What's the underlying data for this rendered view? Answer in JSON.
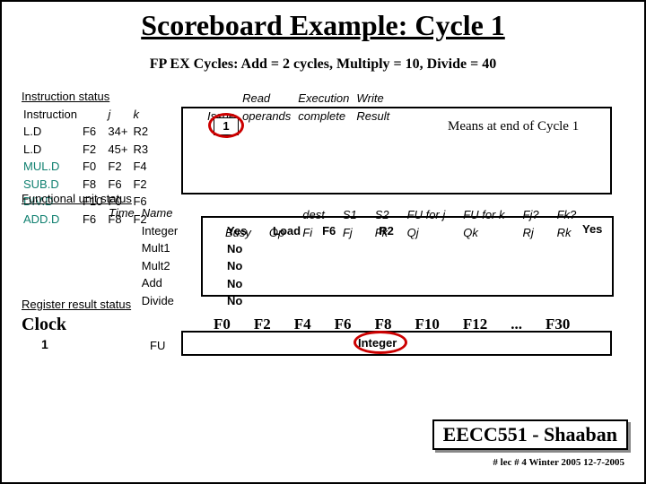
{
  "title": "Scoreboard Example:  Cycle 1",
  "subtitle": "FP EX Cycles:  Add = 2 cycles, Multiply = 10, Divide = 40",
  "instr_status_label": "Instruction status",
  "instr_header": {
    "c0": "Instruction",
    "c1": "j",
    "c2": "k"
  },
  "instructions": [
    {
      "op": "L.D",
      "dst": "F6",
      "j": "34+",
      "k": "R2"
    },
    {
      "op": "L.D",
      "dst": "F2",
      "j": "45+",
      "k": "R3"
    },
    {
      "op": "MUL.D",
      "dst": "F0",
      "j": "F2",
      "k": "F4"
    },
    {
      "op": "SUB.D",
      "dst": "F8",
      "j": "F6",
      "k": "F2"
    },
    {
      "op": "DIV.D",
      "dst": "F10",
      "j": "F0",
      "k": "F6"
    },
    {
      "op": "ADD.D",
      "dst": "F6",
      "j": "F8",
      "k": "F2"
    }
  ],
  "issue_hdr": {
    "a": "Issue",
    "b": "Read",
    "c": "operands",
    "d": "Execution",
    "e": "complete",
    "f": "Write",
    "g": "Result"
  },
  "issue_val": "1",
  "means": "Means at end of Cycle 1",
  "fu_status_label": "Functional unit status",
  "fu_cols": {
    "time": "Time",
    "name": "Name",
    "busy": "Busy",
    "op": "Op",
    "fi": "Fi",
    "fj": "Fj",
    "fk": "Fk",
    "qj": "Qj",
    "qk": "Qk",
    "rj": "Rj",
    "rk": "Rk",
    "dest": "dest",
    "s1": "S1",
    "s2": "S2",
    "fuj": "FU for j",
    "fuk": "FU for k",
    "fjq": "Fj?",
    "fkq": "Fk?"
  },
  "units": [
    {
      "name": "Integer",
      "busy": "Yes",
      "op": "Load",
      "fi": "F6",
      "fk": "R2",
      "rk": "Yes"
    },
    {
      "name": "Mult1",
      "busy": "No"
    },
    {
      "name": "Mult2",
      "busy": "No"
    },
    {
      "name": "Add",
      "busy": "No"
    },
    {
      "name": "Divide",
      "busy": "No"
    }
  ],
  "reg_status_label": "Register result status",
  "clock_label": "Clock",
  "clock_val": "1",
  "fu_label": "FU",
  "regs": [
    "F0",
    "F2",
    "F4",
    "F6",
    "F8",
    "F10",
    "F12",
    "...",
    "F30"
  ],
  "reg_fu": {
    "F6": "Integer"
  },
  "footer": "EECC551 - Shaaban",
  "footer_sub": "#  lec # 4  Winter 2005   12-7-2005"
}
